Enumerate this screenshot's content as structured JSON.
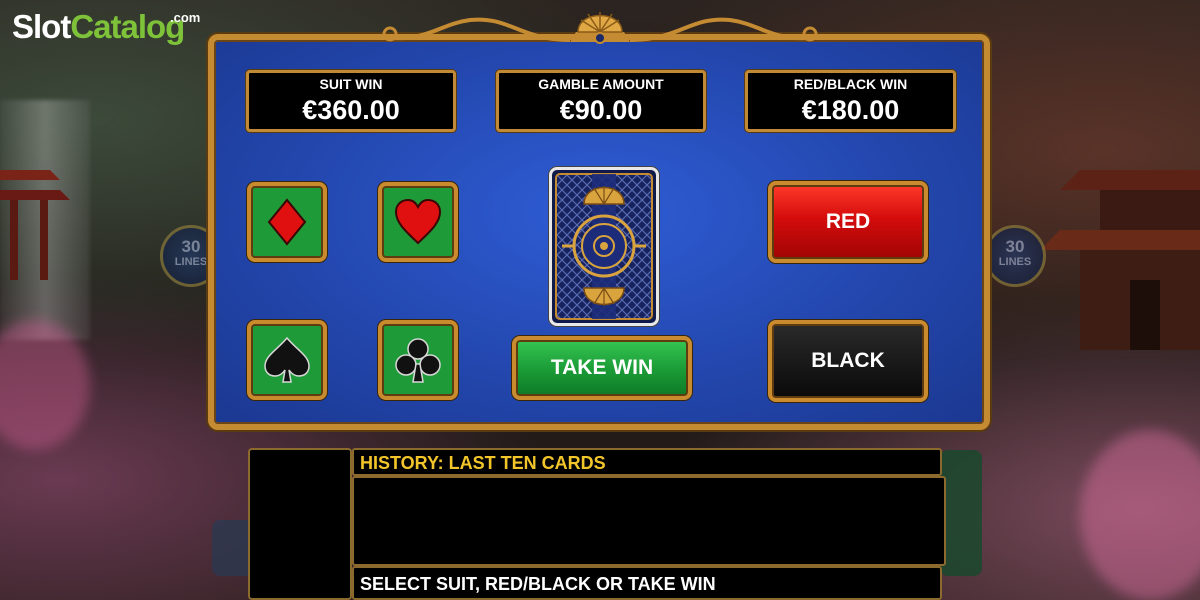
{
  "logo": {
    "part1": "Slot",
    "part2": "Catalog",
    "suffix": ".com"
  },
  "lines_badge": {
    "number": "30",
    "label": "LINES"
  },
  "info": {
    "suit_win": {
      "label": "SUIT WIN",
      "value": "€360.00"
    },
    "gamble_amount": {
      "label": "GAMBLE AMOUNT",
      "value": "€90.00"
    },
    "red_black_win": {
      "label": "RED/BLACK WIN",
      "value": "€180.00"
    }
  },
  "suits": [
    "diamonds",
    "hearts",
    "spades",
    "clubs"
  ],
  "buttons": {
    "red": "RED",
    "black": "BLACK",
    "take_win": "TAKE WIN"
  },
  "history": {
    "title": "HISTORY: LAST TEN CARDS",
    "status": "SELECT SUIT, RED/BLACK OR TAKE WIN"
  },
  "colors": {
    "gold": "#c98b2e",
    "table_blue": "#2347ae",
    "suit_green": "#1f9a38",
    "red": "#d40c0c",
    "history_title": "#f2c62a"
  }
}
